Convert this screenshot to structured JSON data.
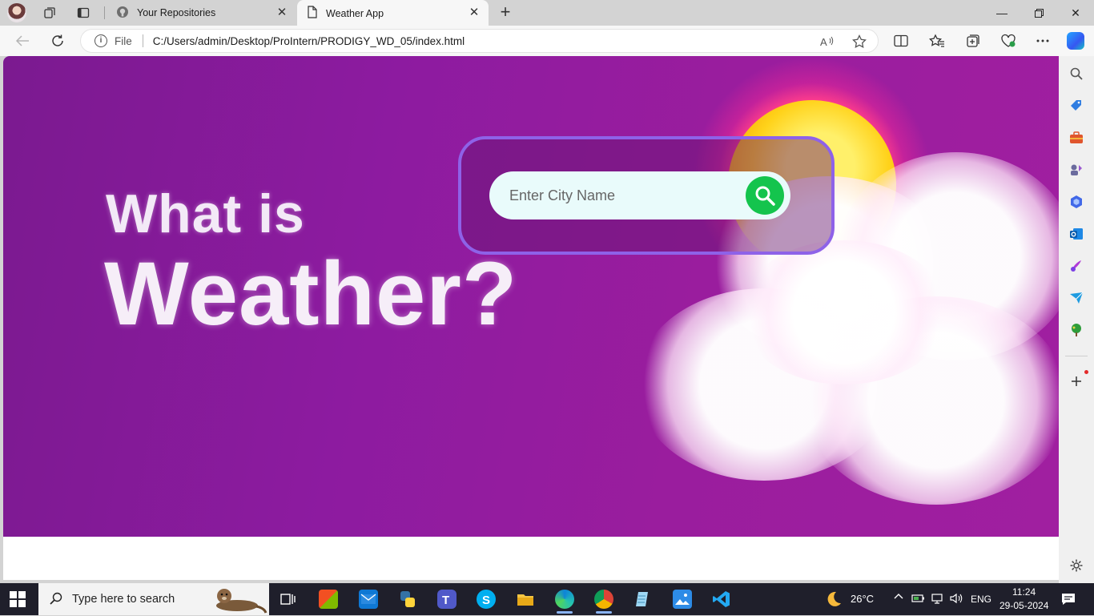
{
  "browser": {
    "tabs": [
      {
        "title": "Your Repositories",
        "icon": "github-icon",
        "active": false
      },
      {
        "title": "Weather App",
        "icon": "page-icon",
        "active": true
      }
    ],
    "address": {
      "scheme_label": "File",
      "url": "C:/Users/admin/Desktop/ProIntern/PRODIGY_WD_05/index.html"
    }
  },
  "page": {
    "hero_line1": "What is",
    "hero_line2": "Weather?",
    "search": {
      "placeholder": "Enter City Name"
    },
    "colors": {
      "accent_border": "#8e62e8",
      "search_button": "#14c44d",
      "background": "#8d1ba0"
    }
  },
  "taskbar": {
    "search_placeholder": "Type here to search",
    "weather_temp": "26°C",
    "language": "ENG",
    "time": "11:24",
    "date": "29-05-2024"
  }
}
